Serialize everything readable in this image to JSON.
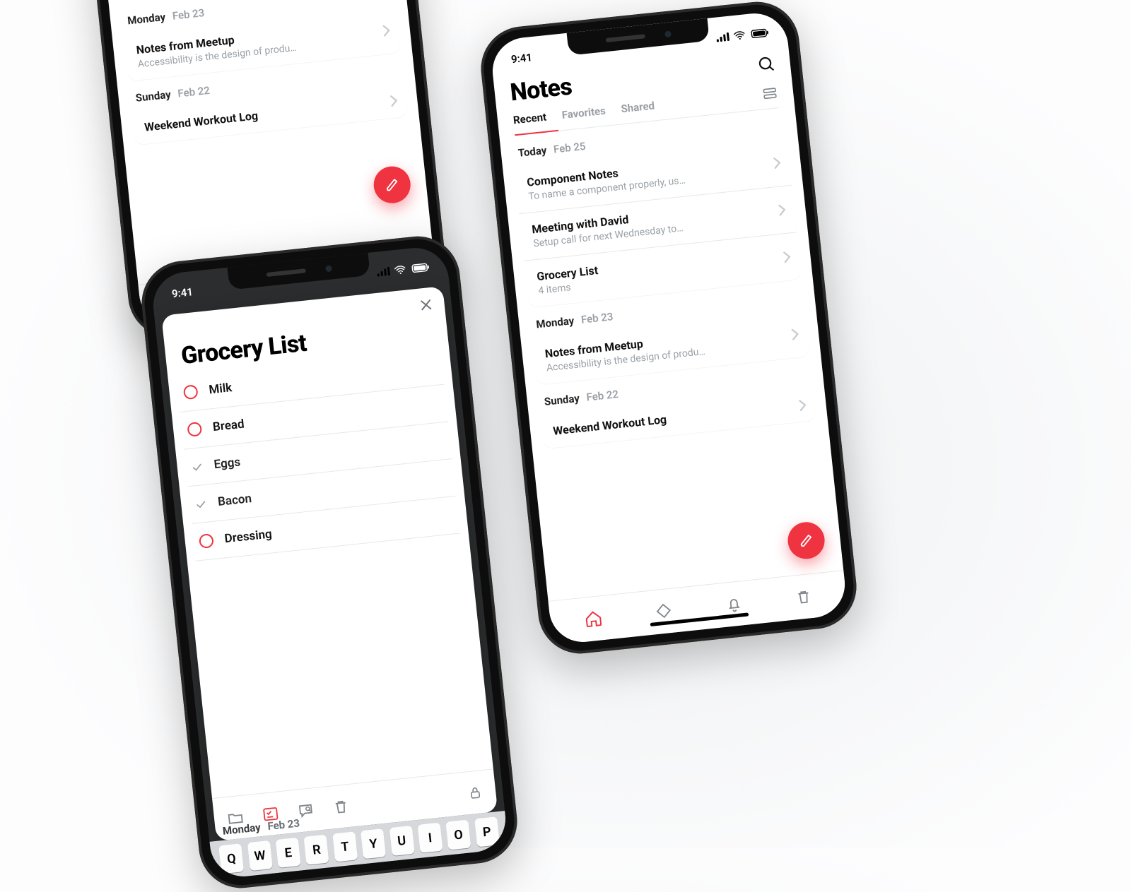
{
  "status": {
    "time": "9:41"
  },
  "notesScreen": {
    "title": "Notes",
    "tabs": {
      "recent": "Recent",
      "favorites": "Favorites",
      "shared": "Shared"
    },
    "sections": [
      {
        "day": "Today",
        "date": "Feb 25",
        "rows": [
          {
            "title": "Component Notes",
            "subtitle": "To name a component properly, us…"
          },
          {
            "title": "Meeting with David",
            "subtitle": "Setup call for next Wednesday to…"
          },
          {
            "title": "Grocery List",
            "subtitle": "4 items"
          }
        ]
      },
      {
        "day": "Monday",
        "date": "Feb 23",
        "rows": [
          {
            "title": "Notes from Meetup",
            "subtitle": "Accessibility is the design of produ…"
          }
        ]
      },
      {
        "day": "Sunday",
        "date": "Feb 22",
        "rows": [
          {
            "title": "Weekend Workout Log",
            "subtitle": ""
          }
        ]
      }
    ]
  },
  "grocery": {
    "title": "Grocery List",
    "items": [
      {
        "label": "Milk",
        "done": false
      },
      {
        "label": "Bread",
        "done": false
      },
      {
        "label": "Eggs",
        "done": true
      },
      {
        "label": "Bacon",
        "done": true
      },
      {
        "label": "Dressing",
        "done": false
      }
    ],
    "bgSection": {
      "day": "Monday",
      "date": "Feb 23"
    }
  },
  "keyboard": {
    "row": [
      "Q",
      "W",
      "E",
      "R",
      "T",
      "Y",
      "U",
      "I",
      "O",
      "P"
    ]
  }
}
